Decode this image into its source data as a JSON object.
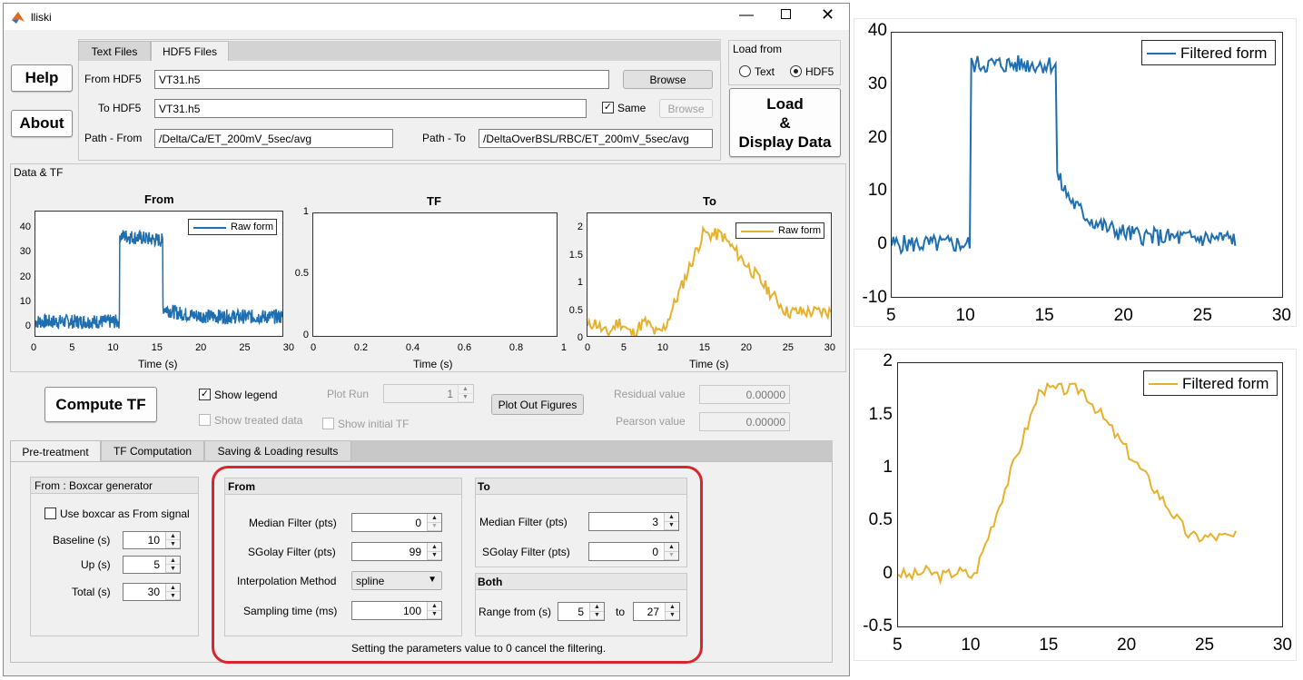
{
  "window": {
    "title": "lliski"
  },
  "top_tabs": [
    "Text Files",
    "HDF5 Files"
  ],
  "buttons": {
    "help": "Help",
    "about": "About",
    "browse1": "Browse",
    "browse2": "Browse",
    "load": [
      "Load",
      "&",
      "Display Data"
    ],
    "compute": "Compute TF",
    "plot_out": "Plot Out Figures"
  },
  "files": {
    "from_hdf5_label": "From HDF5",
    "from_hdf5": "VT31.h5",
    "to_hdf5_label": "To HDF5",
    "to_hdf5": "VT31.h5",
    "same_label": "Same",
    "path_from_label": "Path - From",
    "path_from": "/Delta/Ca/ET_200mV_5sec/avg",
    "path_to_label": "Path - To",
    "path_to": "/DeltaOverBSL/RBC/ET_200mV_5sec/avg"
  },
  "load_from": {
    "title": "Load from",
    "opt_text": "Text",
    "opt_hdf5": "HDF5",
    "selected": "HDF5"
  },
  "data_tf": {
    "title": "Data & TF",
    "from": {
      "title": "From",
      "xlabel": "Time (s)",
      "legend": "Raw form",
      "yticks": [
        "40",
        "30",
        "20",
        "10",
        "0"
      ],
      "xticks": [
        "0",
        "5",
        "10",
        "15",
        "20",
        "25",
        "30"
      ]
    },
    "tf": {
      "title": "TF",
      "xlabel": "Time (s)",
      "yticks": [
        "1",
        "0.5",
        "0"
      ],
      "xticks": [
        "0",
        "0.2",
        "0.4",
        "0.6",
        "0.8",
        "1"
      ]
    },
    "to": {
      "title": "To",
      "xlabel": "Time (s)",
      "legend": "Raw form",
      "yticks": [
        "2",
        "1.5",
        "1",
        "0.5",
        "0"
      ],
      "xticks": [
        "0",
        "5",
        "10",
        "15",
        "20",
        "25",
        "30"
      ]
    }
  },
  "options": {
    "show_legend": "Show legend",
    "show_treated": "Show treated data",
    "plot_run": "Plot Run",
    "plot_run_value": "1",
    "show_initial_tf": "Show initial TF",
    "residual_label": "Residual value",
    "residual_value": "0.00000",
    "pearson_label": "Pearson value",
    "pearson_value": "0.00000"
  },
  "bottom_tabs": [
    "Pre-treatment",
    "TF Computation",
    "Saving & Loading results"
  ],
  "boxcar": {
    "title": "From : Boxcar generator",
    "use_label": "Use boxcar as From signal",
    "baseline_label": "Baseline (s)",
    "baseline": "10",
    "up_label": "Up (s)",
    "up": "5",
    "total_label": "Total (s)",
    "total": "30"
  },
  "from_panel": {
    "title": "From",
    "median_label": "Median Filter (pts)",
    "median": "0",
    "sgolay_label": "SGolay Filter (pts)",
    "sgolay": "99",
    "interp_label": "Interpolation Method",
    "interp": "spline",
    "sampling_label": "Sampling time (ms)",
    "sampling": "100"
  },
  "to_panel": {
    "title": "To",
    "median_label": "Median Filter (pts)",
    "median": "3",
    "sgolay_label": "SGolay Filter (pts)",
    "sgolay": "0"
  },
  "both_panel": {
    "title": "Both",
    "range_label": "Range from (s)",
    "range_from": "5",
    "to_label": "to",
    "range_to": "27"
  },
  "note": "Setting the parameters value to 0 cancel the filtering.",
  "fig_top": {
    "legend": "Filtered form",
    "yticks": [
      "40",
      "30",
      "20",
      "10",
      "0",
      "-10"
    ],
    "xticks": [
      "5",
      "10",
      "15",
      "20",
      "25",
      "30"
    ]
  },
  "fig_bottom": {
    "legend": "Filtered form",
    "yticks": [
      "2",
      "1.5",
      "1",
      "0.5",
      "0",
      "-0.5"
    ],
    "xticks": [
      "5",
      "10",
      "15",
      "20",
      "25",
      "30"
    ]
  },
  "colors": {
    "blue": "#1f6fb0",
    "orange": "#e6b12c",
    "highlight": "#d9262e"
  }
}
